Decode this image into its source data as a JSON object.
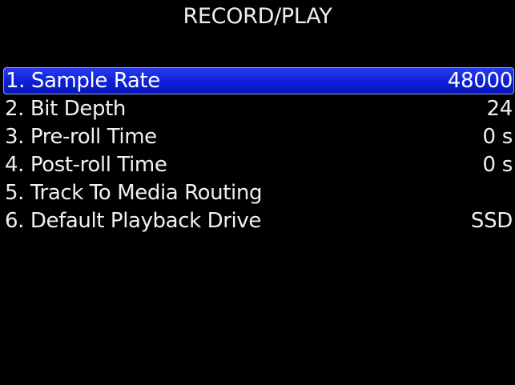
{
  "header": {
    "title": "RECORD/PLAY"
  },
  "menu": {
    "items": [
      {
        "label": "1. Sample Rate",
        "value": "48000",
        "selected": true
      },
      {
        "label": "2. Bit Depth",
        "value": "24",
        "selected": false
      },
      {
        "label": "3. Pre-roll Time",
        "value": "0 s",
        "selected": false
      },
      {
        "label": "4. Post-roll Time",
        "value": "0 s",
        "selected": false
      },
      {
        "label": "5. Track To Media Routing",
        "value": "",
        "selected": false
      },
      {
        "label": "6. Default Playback Drive",
        "value": "SSD",
        "selected": false
      }
    ]
  },
  "colors": {
    "background": "#000000",
    "text": "#f0f0f0",
    "selection": "#1428e0",
    "selection_border": "#8fa0ff"
  }
}
